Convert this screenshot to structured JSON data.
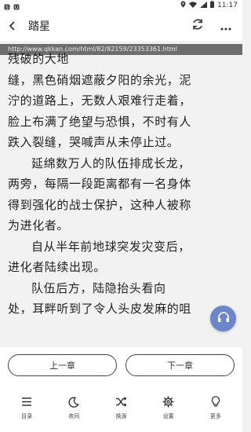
{
  "status_bar": {
    "time": "11:17",
    "icons": [
      "app-s-icon",
      "app-u-icon",
      "location-icon",
      "wifi-icon",
      "cellular-icon",
      "battery-icon"
    ]
  },
  "header": {
    "title": "踏星",
    "back_icon": "chevron-left-icon",
    "refresh_icon": "refresh-icon",
    "more_icon": "more-icon"
  },
  "url": "http://www.qkkan.com/html/82/82159/23353361.html",
  "content": {
    "lines": [
      {
        "text": "残破的大地",
        "indent": false
      },
      {
        "text": "缝，黑色硝烟遮蔽夕阳的余光，泥",
        "indent": false
      },
      {
        "text": "泞的道路上，无数人艰难行走着，",
        "indent": false
      },
      {
        "text": "脸上布满了绝望与恐惧，不时有人",
        "indent": false
      },
      {
        "text": "跌入裂缝，哭喊声从未停止过。",
        "indent": false
      },
      {
        "text": "延绵数万人的队伍排成长龙，",
        "indent": true
      },
      {
        "text": "两旁，每隔一段距离都有一名身体",
        "indent": false
      },
      {
        "text": "得到强化的战士保护，这种人被称",
        "indent": false
      },
      {
        "text": "为进化者。",
        "indent": false
      },
      {
        "text": "自从半年前地球突发灾变后，",
        "indent": true
      },
      {
        "text": "进化者陆续出现。",
        "indent": false
      },
      {
        "text": "队伍后方，陆隐抬头看向",
        "indent": true
      },
      {
        "text": "处，耳畔听到了令人头皮发麻的咀",
        "indent": false
      }
    ]
  },
  "audio_button_icon": "headphones-icon",
  "chapter_nav": {
    "prev_label": "上一章",
    "next_label": "下一章"
  },
  "toolbar": {
    "items": [
      {
        "label": "目录",
        "icon": "list-icon"
      },
      {
        "label": "夜间",
        "icon": "moon-icon"
      },
      {
        "label": "换源",
        "icon": "shuffle-icon"
      },
      {
        "label": "设置",
        "icon": "gear-icon"
      },
      {
        "label": "更多",
        "icon": "bulb-icon"
      }
    ]
  }
}
